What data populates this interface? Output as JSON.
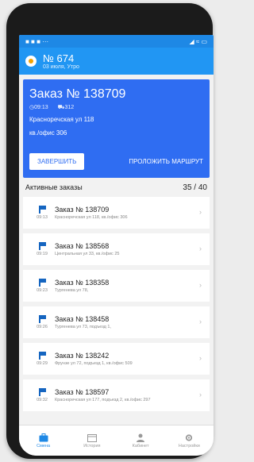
{
  "shift": {
    "number": "№ 674",
    "subtitle": "03 июля, Утро"
  },
  "current_order": {
    "title": "Заказ № 138709",
    "time": "09:13",
    "code": "312",
    "address": "Красноречская ул 118",
    "apartment": "кв./офис 306",
    "finish_label": "ЗАВЕРШИТЬ",
    "route_label": "ПРОЛОЖИТЬ МАРШРУТ"
  },
  "active_orders": {
    "label": "Активные заказы",
    "count": "35 / 40",
    "items": [
      {
        "title": "Заказ № 138709",
        "time": "09:13",
        "address": "Красноречская ул 118, кв./офис 306"
      },
      {
        "title": "Заказ № 138568",
        "time": "09:19",
        "address": "Центральная ул 33, кв./офис 25"
      },
      {
        "title": "Заказ № 138358",
        "time": "09:23",
        "address": "Тургенева ул 78,"
      },
      {
        "title": "Заказ № 138458",
        "time": "09:26",
        "address": "Тургенева ул 73, подъезд 1,"
      },
      {
        "title": "Заказ № 138242",
        "time": "09:29",
        "address": "Фрунзе ул 72, подъезд 1, кв./офис 509"
      },
      {
        "title": "Заказ № 138597",
        "time": "09:32",
        "address": "Красноречская ул 177, подъезд 2, кв./офис 297"
      }
    ]
  },
  "nav": [
    {
      "label": "Смена",
      "icon": "briefcase-icon",
      "active": true
    },
    {
      "label": "История",
      "icon": "calendar-icon",
      "active": false
    },
    {
      "label": "Кабинет",
      "icon": "person-icon",
      "active": false
    },
    {
      "label": "Настройки",
      "icon": "gear-icon",
      "active": false
    }
  ],
  "colors": {
    "primary": "#2196f3",
    "card": "#2f6df2",
    "flag": "#1565c0"
  }
}
